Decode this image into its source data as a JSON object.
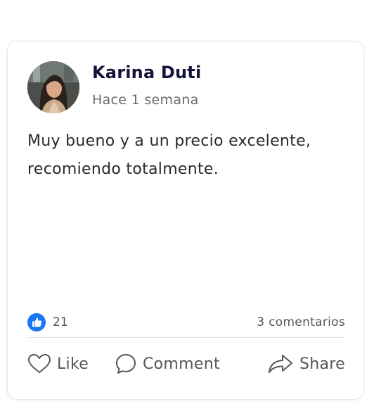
{
  "post": {
    "author": "Karina Duti",
    "time": "Hace 1 semana",
    "body": "Muy bueno y a un precio excelente, recomiendo totalmente.",
    "likes": "21",
    "comments": "3 comentarios"
  },
  "actions": {
    "like_label": "Like",
    "comment_label": "Comment",
    "share_label": "Share"
  },
  "icons": {
    "like_badge": "thumbs-up-icon",
    "like": "heart-icon",
    "comment": "speech-bubble-icon",
    "share": "share-arrow-icon"
  },
  "colors": {
    "author": "#14143a",
    "like_badge": "#1877f2",
    "muted": "#6b6b6b"
  }
}
